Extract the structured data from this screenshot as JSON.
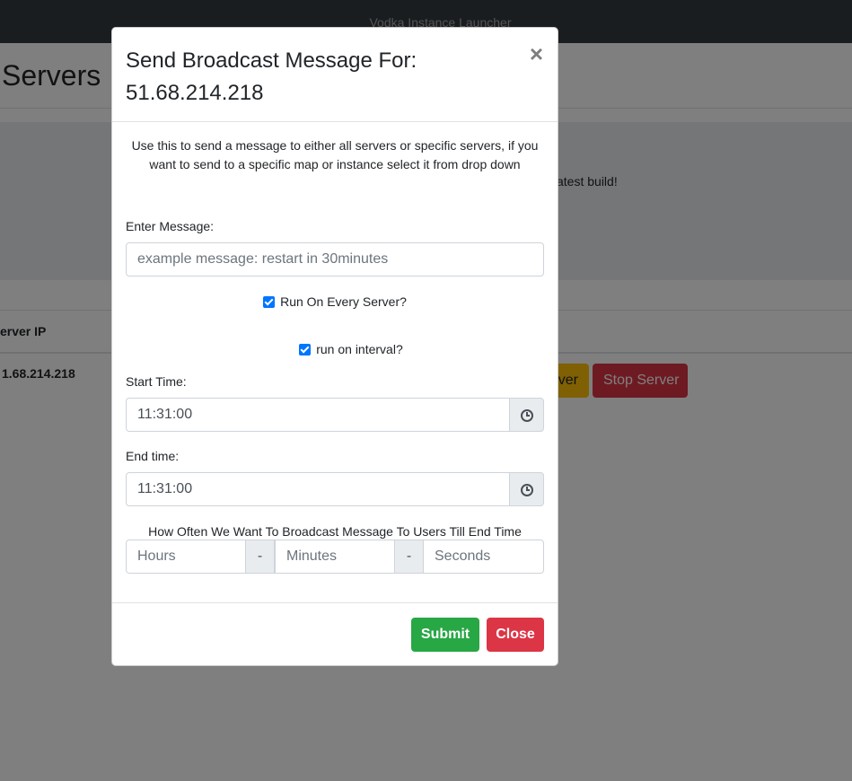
{
  "navbar": {
    "brand": "Vodka Instance Launcher"
  },
  "page": {
    "title": "Servers",
    "jumbotron_text": "atest build!",
    "table": {
      "header_ip": "erver IP",
      "row_ip": "1.68.214.218",
      "warning_button": "ver",
      "stop_button": "Stop Server"
    }
  },
  "modal": {
    "title_line1": "Send Broadcast Message For:",
    "title_line2": "51.68.214.218",
    "close_symbol": "×",
    "intro": "Use this to send a message to either all servers or specific servers, if you want to send to a specific map or instance select it from drop down",
    "message_label": "Enter Message:",
    "message_placeholder": "example message: restart in 30minutes",
    "run_every_server_label": "Run On Every Server?",
    "run_every_server_checked": true,
    "run_on_interval_label": "run on interval?",
    "run_on_interval_checked": true,
    "start_time_label": "Start Time:",
    "start_time_value": "11:31:00",
    "end_time_label": "End time:",
    "end_time_value": "11:31:00",
    "interval_title": "How Often We Want To Broadcast Message To Users Till End Time",
    "hours_placeholder": "Hours",
    "minutes_placeholder": "Minutes",
    "seconds_placeholder": "Seconds",
    "separator": "-",
    "submit_label": "Submit",
    "close_label": "Close"
  },
  "colors": {
    "navbar": "#343a40",
    "success": "#28a745",
    "danger": "#dc3545",
    "warning": "#ffc107",
    "checkbox": "#0075ff"
  }
}
